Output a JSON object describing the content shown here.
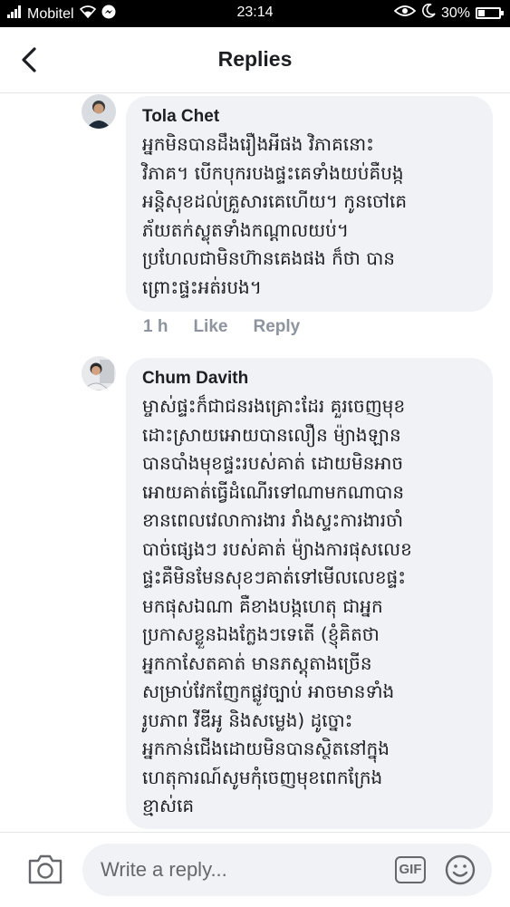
{
  "status_bar": {
    "carrier": "Mobitel",
    "time": "23:14",
    "battery": "30%",
    "battery_level": 0.3,
    "icons": [
      "wifi-icon",
      "messenger-icon",
      "eye-icon",
      "moon-icon",
      "battery-icon"
    ]
  },
  "header": {
    "title": "Replies",
    "back_icon": "chevron-left-icon"
  },
  "comments": [
    {
      "author": "Tola Chet",
      "lines": [
        "អ្នកមិនបានដឹងរឿងអីផង វិភាគនោះ",
        "វិភាគ។ បើកបុករបងផ្ទះគេទាំងយប់គឺបង្ក",
        "អន្តិសុខដល់គ្រួសារគេហើយ។ កូនចៅគេ",
        "ភ័យតក់ស្លុតទាំងកណ្ដាលយប់។",
        "ប្រហែលជាមិនហ៊ានគេងផង ក៏ថា បាន",
        "ព្រោះផ្ទះអត់របង។"
      ],
      "time": "1 h",
      "like_label": "Like",
      "reply_label": "Reply"
    },
    {
      "author": "Chum Davith",
      "lines": [
        "ម្ចាស់ផ្ទះក៏ជាជនរងគ្រោះដែរ គួរចេញមុខ",
        "ដោះស្រាយអោយបានលឿន ម៉្យាងឡាន",
        "បានបាំងមុខផ្ទះរបស់គាត់ ដោយមិនអាច",
        "អោយគាត់ធ្វើដំណើរទៅណាមកណាបាន",
        "ខានពេលវេលាការងារ រាំងស្ទះការងារចាំ",
        "បាច់ផ្សេងៗ របស់គាត់ ម៉្យាងការផុសលេខ",
        "ផ្ទះគឺមិនមែនសុខៗគាត់ទៅមើលលេខផ្ទះ",
        "មកផុសឯណា គឺខាងបង្កហេតុ ជាអ្នក",
        "ប្រកាសខ្លួនឯងក្លែងៗទេតើ (ខ្ញុំគិតថា",
        "អ្នកកាសែតគាត់ មានភស្តុតាងច្រើន",
        "សម្រាប់វែកញែកផ្លូវច្បាប់ អាចមានទាំង",
        "រូបភាព វីឌីអូ និងសម្លេង) ដូច្នោះ",
        "អ្នកកាន់ជើងដោយមិនបានស្ថិតនៅក្នុង",
        "ហេតុការណ៍សូមកុំចេញមុខពេកក្រែង",
        "ខ្មាស់គេ"
      ]
    }
  ],
  "composer": {
    "placeholder": "Write a reply...",
    "gif_label": "GIF",
    "camera_icon": "camera-icon",
    "emoji_icon": "smiley-icon"
  }
}
